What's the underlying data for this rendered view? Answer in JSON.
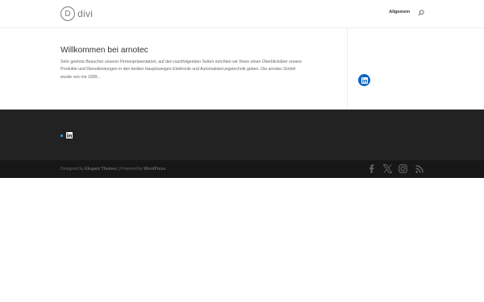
{
  "header": {
    "logo_letter": "D",
    "logo_text": "divi",
    "nav_item": "Allgemein"
  },
  "post": {
    "title": "Willkommen bei arnotec",
    "excerpt": "Sehr geehrte Besucher unserer Firmenpräsentation, auf den nachfolgenden Seiten möchten wir Ihnen einen Überblicküber unsere Produkte und Dienstleistungen in den beiden Hauptzweigen Elektronik und Automatisierungstechnik geben. Die arnotec GmbH wurde von mir 1999..."
  },
  "credits": {
    "designed_prefix": "Designed by ",
    "designed_link": "Elegant Themes",
    "separator": " | Powered by ",
    "powered_link": "WordPress"
  },
  "social_icons": [
    "facebook-icon",
    "x-icon",
    "instagram-icon",
    "rss-icon"
  ],
  "colors": {
    "accent": "#2ea3f2",
    "linkedin": "#0d66c2",
    "footer_bg": "#222222",
    "bottom_bar_bg": "#171717"
  }
}
